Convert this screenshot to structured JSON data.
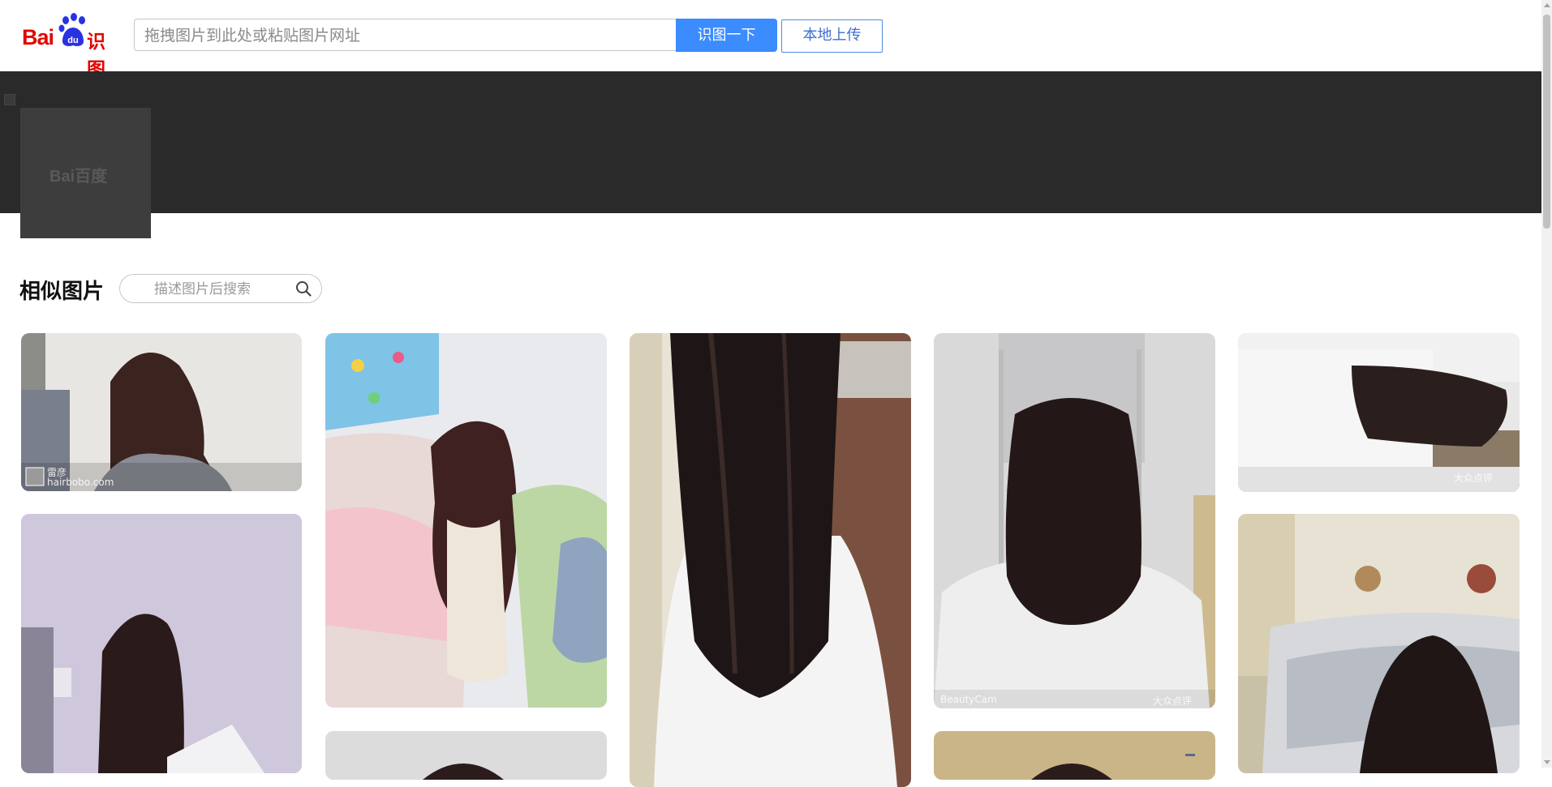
{
  "header": {
    "logo_text": "Bai",
    "logo_product": "识图",
    "search_placeholder": "拖拽图片到此处或粘贴图片网址",
    "search_button": "识图一下",
    "upload_button": "本地上传"
  },
  "query": {
    "watermark": "Bai百度"
  },
  "similar": {
    "title": "相似图片",
    "search_placeholder": "描述图片后搜索"
  },
  "results": [
    {
      "watermark": "雷彦",
      "watermark2": "hairbobo.com"
    },
    {
      "watermark": ""
    },
    {
      "watermark": ""
    },
    {
      "watermark": "BeautyCam",
      "watermark2": "大众点评"
    },
    {
      "watermark": "大众点评"
    },
    {
      "watermark": ""
    },
    {
      "watermark": ""
    },
    {
      "watermark": ""
    },
    {
      "watermark": ""
    }
  ],
  "colors": {
    "brand_red": "#e10601",
    "brand_blue": "#3b8cff",
    "band": "#2a2a2a"
  }
}
